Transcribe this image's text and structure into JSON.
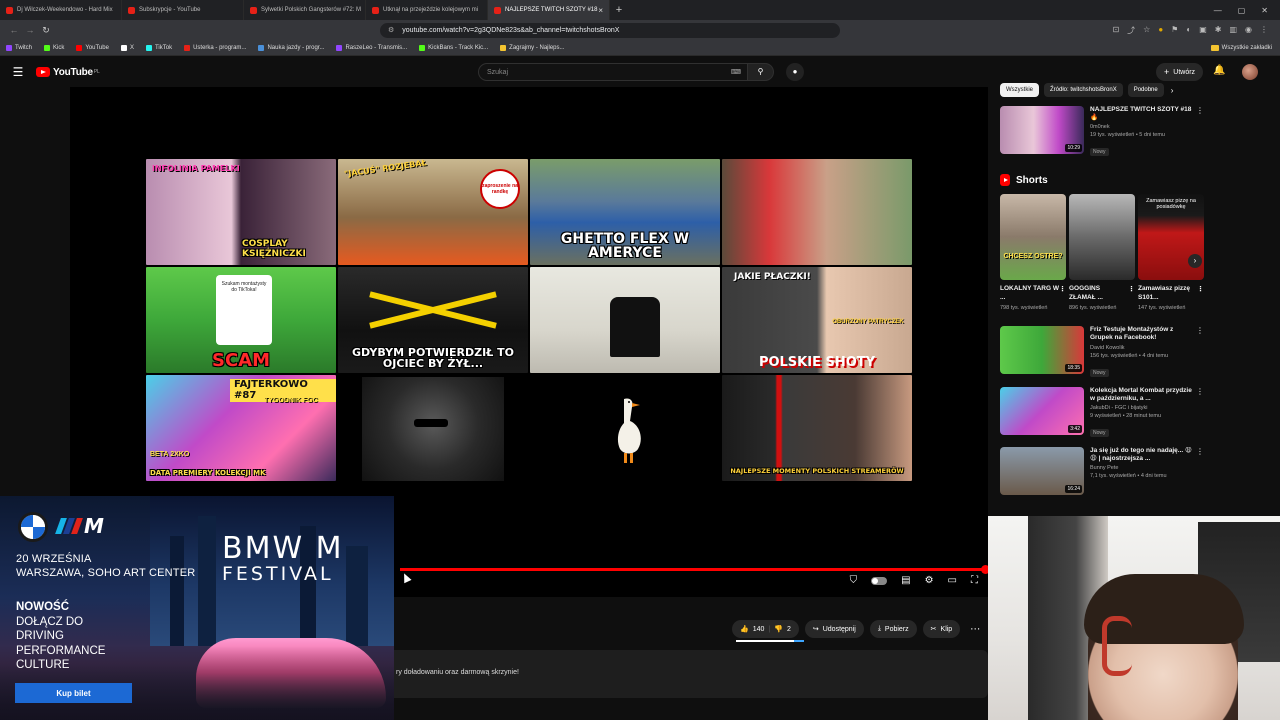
{
  "browser": {
    "tabs": [
      {
        "label": "Dj Wilczek-Weekendowo - Hard Mix",
        "active": false
      },
      {
        "label": "Subskrypcje - YouTube",
        "active": false
      },
      {
        "label": "Sylwetki Polskich Gangsterów #72: M",
        "active": false
      },
      {
        "label": "Utknął na przejeździe kolejowym mi",
        "active": false
      },
      {
        "label": "NAJLEPSZE TWITCH SZOTY #18",
        "active": true
      }
    ],
    "url": "youtube.com/watch?v=2g3QDNe823s&ab_channel=twitchshotsBronX",
    "bookmarks": [
      "Twitch",
      "Kick",
      "YouTube",
      "X",
      "TikTok",
      "Usterka - program...",
      "Nauka jazdy - progr...",
      "RaszeLeo - Transmis...",
      "KickBans - Track Kic...",
      "Zagrajmy - Najleps..."
    ],
    "bookmarks_folder": "Wszystkie zakładki",
    "colors": {
      "tabbar": "#202124",
      "toolbar": "#35363a"
    }
  },
  "youtube": {
    "logo_text": "YouTube",
    "logo_region": "PL",
    "search_placeholder": "Szukaj",
    "create_label": "Utwórz",
    "accent": "#ff0000"
  },
  "video": {
    "thumbnails": [
      {
        "caption": "COSPLAY KSIĘŻNICZKI",
        "top": "INFOLINIA PAMELKI"
      },
      {
        "caption": "",
        "top": "\"JACUŚ\" ROZJEBAŁ"
      },
      {
        "caption": "GHETTO FLEX W AMERYCE",
        "top": ""
      },
      {
        "caption": "",
        "top": ""
      },
      {
        "caption": "SCAM",
        "top": "Szukam montażysty do TikToka!"
      },
      {
        "caption": "GDYBYM POTWIERDZIŁ TO OJCIEC BY ŻYŁ...",
        "top": ""
      },
      {
        "caption": "",
        "top": ""
      },
      {
        "caption": "POLSKIE SHOTY",
        "top": "JAKIE PŁACZKI!"
      },
      {
        "caption": "DATA PREMIERY KOLEKCJI MK",
        "top": "FAJTERKOWO #87"
      },
      {
        "caption": "",
        "top": ""
      },
      {
        "caption": "",
        "top": ""
      },
      {
        "caption": "NAJLEPSZE MOMENTY POLSKICH STREAMERÓW",
        "top": ""
      }
    ],
    "thumb_extra": {
      "sub_fgc": "TYGODNIK FGC",
      "beta": "BETA 2XKO",
      "oburzony": "OBURZONY PATRYCZEK",
      "zaproszenie": "zaproszenie na randkę"
    },
    "progress": 1.0
  },
  "actions": {
    "likes": "140",
    "dislikes": "2",
    "share": "Udostępnij",
    "download": "Pobierz",
    "clip": "Klip"
  },
  "description_snippet": "ry doładowaniu oraz darmową skrzynie!",
  "sidebar": {
    "chips": [
      "Wszystkie",
      "Źródło: twitchshotsBronX",
      "Podobne"
    ],
    "recs_top": [
      {
        "title": "NAJLEPSZE TWITCH SZOTY #18🔥",
        "channel": "0m0nek",
        "stats": "19 tys. wyświetleń • 5 dni temu",
        "badge": "Nowy",
        "duration": "10:29"
      }
    ],
    "shorts_title": "Shorts",
    "shorts": [
      {
        "title": "LOKALNY TARG W ...",
        "views": "798 tys. wyświetleń",
        "overlay": "CHCESZ OSTRE?"
      },
      {
        "title": "GOGGINS ZŁAMAŁ ...",
        "views": "896 tys. wyświetleń",
        "overlay": ""
      },
      {
        "title": "Zamawiasz pizzę S101...",
        "views": "147 tys. wyświetleń",
        "overlay": "Zamawiasz pizzę na posiadówkę"
      }
    ],
    "recs_bottom": [
      {
        "title": "Friz Testuje Montażystów z Grupek na Facebook!",
        "channel": "David Kowolik",
        "stats": "156 tys. wyświetleń • 4 dni temu",
        "badge": "Nowy",
        "duration": "18:35"
      },
      {
        "title": "Kolekcja Mortal Kombat przydzie w październiku, a ...",
        "channel": "JakubDi - FGC i bijatyki",
        "stats": "9 wyświetleń • 28 minut temu",
        "badge": "Nowy",
        "duration": "3:42"
      },
      {
        "title": "Ja się już do tego nie nadaję... 😩😩 | najostrzejsza ...",
        "channel": "Bunny Pete",
        "stats": "7,1 tys. wyświetleń • 4 dni temu",
        "badge": "",
        "duration": "16:24"
      }
    ]
  },
  "ad": {
    "brand_m": "M",
    "date_line1": "20 WRZEŚNIA",
    "date_line2": "WARSZAWA, SOHO ART CENTER",
    "cta_bold": "NOWOŚĆ",
    "cta_lines": [
      "DOŁĄCZ DO",
      "DRIVING",
      "PERFORMANCE",
      "CULTURE"
    ],
    "festival_line1": "BMW M",
    "festival_line2": "FESTIVAL",
    "button": "Kup bilet",
    "colors": {
      "button": "#1c69d4",
      "m_stripes": [
        "#16b4e8",
        "#1c3f94",
        "#e2231a"
      ]
    }
  }
}
